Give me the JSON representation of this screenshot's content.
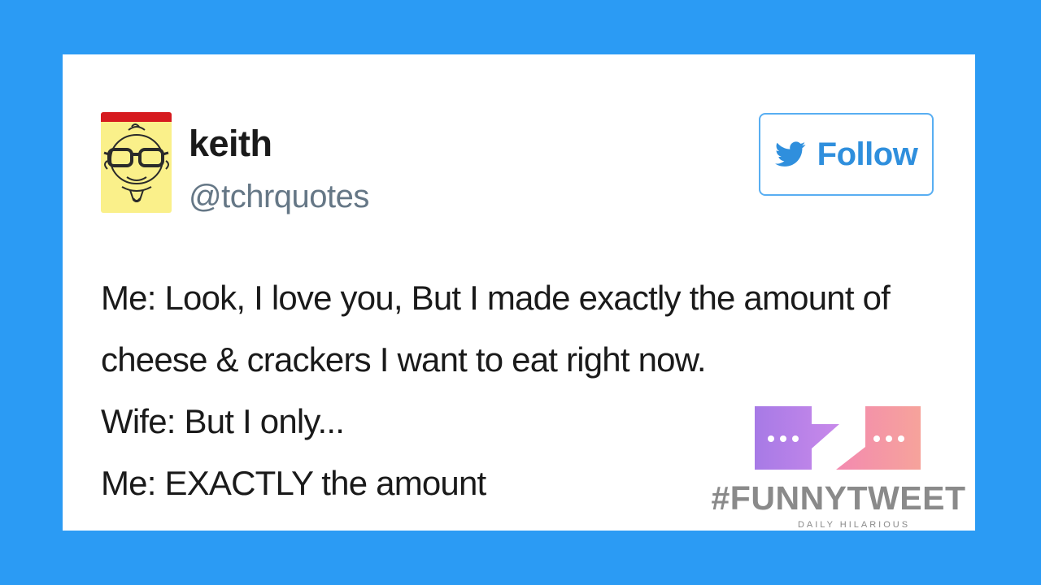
{
  "tweet": {
    "display_name": "keith",
    "handle": "@tchrquotes",
    "follow_label": "Follow",
    "lines": [
      "Me: Look, I love you, But I made exactly the amount of",
      "cheese & crackers I want to eat right now.",
      "Wife: But I only...",
      "Me: EXACTLY the amount"
    ]
  },
  "watermark": {
    "title": "#FUNNYTWEET",
    "subtitle": "DAILY HILARIOUS"
  },
  "icons": {
    "avatar": "cartoon-face-with-glasses-icon",
    "follow": "twitter-bird-icon",
    "watermark": "chat-bubbles-icon"
  },
  "colors": {
    "background": "#2b9bf4",
    "card": "#ffffff",
    "follow_accent": "#2f8fdd",
    "handle": "#657786",
    "bubble_left": "#b87fe8",
    "bubble_right": "#f28fa5"
  }
}
